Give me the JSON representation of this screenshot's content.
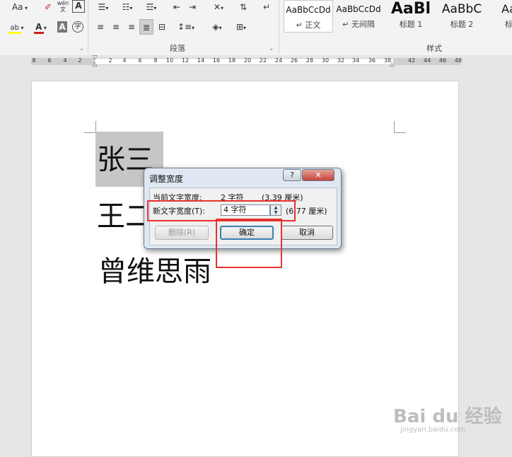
{
  "ribbon": {
    "font_size_label": "Aa",
    "phonetic_label": "wén\n文",
    "char_border_label": "A",
    "char_shading_label": "A",
    "enclose_char_label": "字",
    "highlight_label": "ab",
    "font_color_label": "A",
    "paragraph_group": "段落",
    "styles_group": "样式",
    "styles": [
      {
        "preview": "AaBbCcDd",
        "name": "↵ 正文",
        "active": true
      },
      {
        "preview": "AaBbCcDd",
        "name": "↵ 无间隔",
        "active": false
      },
      {
        "preview": "AaBl",
        "name": "标题 1",
        "active": false
      },
      {
        "preview": "AaBbC",
        "name": "标题 2",
        "active": false
      },
      {
        "preview": "AaB",
        "name": "标题",
        "active": false
      }
    ]
  },
  "ruler": {
    "ticks": [
      "8",
      "6",
      "4",
      "2",
      "2",
      "4",
      "6",
      "8",
      "10",
      "12",
      "14",
      "16",
      "18",
      "20",
      "22",
      "24",
      "26",
      "28",
      "30",
      "32",
      "34",
      "36",
      "38",
      "42",
      "44",
      "46",
      "48"
    ]
  },
  "document": {
    "lines": [
      "张三",
      "王二",
      "曾维思雨"
    ]
  },
  "dialog": {
    "title": "调整宽度",
    "help": "?",
    "close": "✕",
    "current_width_label": "当前文字宽度:",
    "current_width_value": "2 字符",
    "current_width_cm": "(3.39 厘米)",
    "new_width_label": "新文字宽度(T):",
    "new_width_value": "4 字符",
    "new_width_cm": "(6.77 厘米)",
    "delete_button": "删除(R)",
    "ok_button": "确定",
    "cancel_button": "取消"
  },
  "watermark": {
    "brand": "Bai du 经验",
    "url": "jingyan.baidu.com"
  },
  "colors": {
    "annotation_red": "#e8332b",
    "highlight_yellow": "#ffff00",
    "font_color_red": "#d0201a"
  }
}
